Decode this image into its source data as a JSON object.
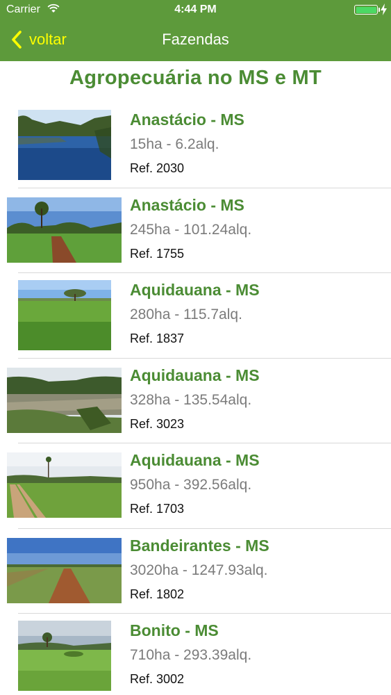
{
  "status_bar": {
    "carrier": "Carrier",
    "time": "4:44 PM",
    "battery_color": "#4cd964"
  },
  "nav": {
    "back_label": "voltar",
    "title": "Fazendas",
    "back_color": "#ffff00",
    "bar_color": "#5d9a3b"
  },
  "heading": "Agropecuária no MS e MT",
  "accent_color": "#4b8c34",
  "farms": [
    {
      "name": "Anastácio - MS",
      "area": "15ha - 6.2alq.",
      "ref": "Ref. 2030",
      "photo": "river-photo"
    },
    {
      "name": "Anastácio - MS",
      "area": "245ha - 101.24alq.",
      "ref": "Ref. 1755",
      "photo": "pasture-road-photo"
    },
    {
      "name": "Aquidauana - MS",
      "area": "280ha - 115.7alq.",
      "ref": "Ref. 1837",
      "photo": "grass-field-photo"
    },
    {
      "name": "Aquidauana - MS",
      "area": "328ha - 135.54alq.",
      "ref": "Ref. 3023",
      "photo": "river-bank-photo"
    },
    {
      "name": "Aquidauana - MS",
      "area": "950ha - 392.56alq.",
      "ref": "Ref. 1703",
      "photo": "pasture-road-photo"
    },
    {
      "name": "Bandeirantes - MS",
      "area": "3020ha - 1247.93alq.",
      "ref": "Ref. 1802",
      "photo": "dirt-road-photo"
    },
    {
      "name": "Bonito - MS",
      "area": "710ha - 293.39alq.",
      "ref": "Ref. 3002",
      "photo": "grass-field-photo"
    }
  ]
}
